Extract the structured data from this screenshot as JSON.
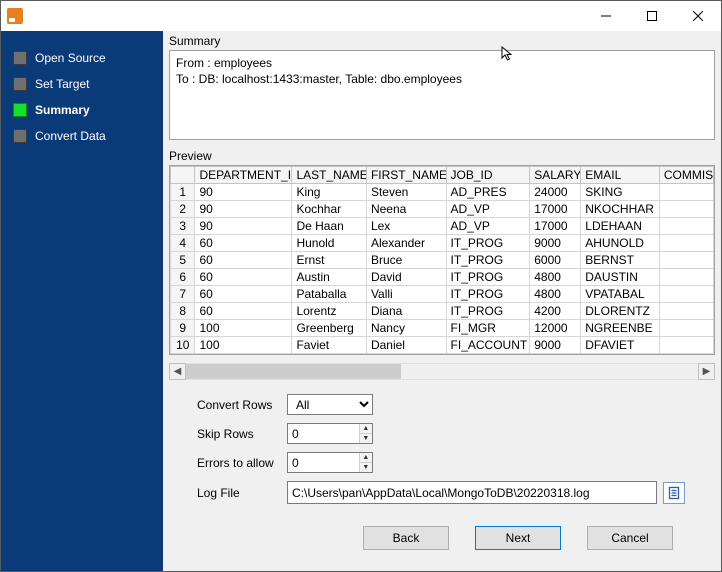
{
  "titlebar": {
    "title": ""
  },
  "sidebar": {
    "steps": [
      {
        "label": "Open Source",
        "active": false
      },
      {
        "label": "Set Target",
        "active": false
      },
      {
        "label": "Summary",
        "active": true
      },
      {
        "label": "Convert Data",
        "active": false
      }
    ]
  },
  "summary": {
    "heading": "Summary",
    "text": "From : employees\nTo : DB: localhost:1433:master, Table: dbo.employees"
  },
  "preview": {
    "heading": "Preview",
    "columns": [
      "DEPARTMENT_ID",
      "LAST_NAME",
      "FIRST_NAME",
      "JOB_ID",
      "SALARY",
      "EMAIL",
      "COMMIS"
    ],
    "rows": [
      {
        "n": "1",
        "cells": [
          "90",
          "King",
          "Steven",
          "AD_PRES",
          "24000",
          "SKING",
          ""
        ]
      },
      {
        "n": "2",
        "cells": [
          "90",
          "Kochhar",
          "Neena",
          "AD_VP",
          "17000",
          "NKOCHHAR",
          ""
        ]
      },
      {
        "n": "3",
        "cells": [
          "90",
          "De Haan",
          "Lex",
          "AD_VP",
          "17000",
          "LDEHAAN",
          ""
        ]
      },
      {
        "n": "4",
        "cells": [
          "60",
          "Hunold",
          "Alexander",
          "IT_PROG",
          "9000",
          "AHUNOLD",
          ""
        ]
      },
      {
        "n": "5",
        "cells": [
          "60",
          "Ernst",
          "Bruce",
          "IT_PROG",
          "6000",
          "BERNST",
          ""
        ]
      },
      {
        "n": "6",
        "cells": [
          "60",
          "Austin",
          "David",
          "IT_PROG",
          "4800",
          "DAUSTIN",
          ""
        ]
      },
      {
        "n": "7",
        "cells": [
          "60",
          "Pataballa",
          "Valli",
          "IT_PROG",
          "4800",
          "VPATABAL",
          ""
        ]
      },
      {
        "n": "8",
        "cells": [
          "60",
          "Lorentz",
          "Diana",
          "IT_PROG",
          "4200",
          "DLORENTZ",
          ""
        ]
      },
      {
        "n": "9",
        "cells": [
          "100",
          "Greenberg",
          "Nancy",
          "FI_MGR",
          "12000",
          "NGREENBE",
          ""
        ]
      },
      {
        "n": "10",
        "cells": [
          "100",
          "Faviet",
          "Daniel",
          "FI_ACCOUNT",
          "9000",
          "DFAVIET",
          ""
        ]
      }
    ]
  },
  "form": {
    "convert_rows_label": "Convert Rows",
    "convert_rows_value": "All",
    "skip_rows_label": "Skip Rows",
    "skip_rows_value": "0",
    "errors_label": "Errors to allow",
    "errors_value": "0",
    "log_label": "Log File",
    "log_value": "C:\\Users\\pan\\AppData\\Local\\MongoToDB\\20220318.log"
  },
  "footer": {
    "back": "Back",
    "next": "Next",
    "cancel": "Cancel"
  }
}
